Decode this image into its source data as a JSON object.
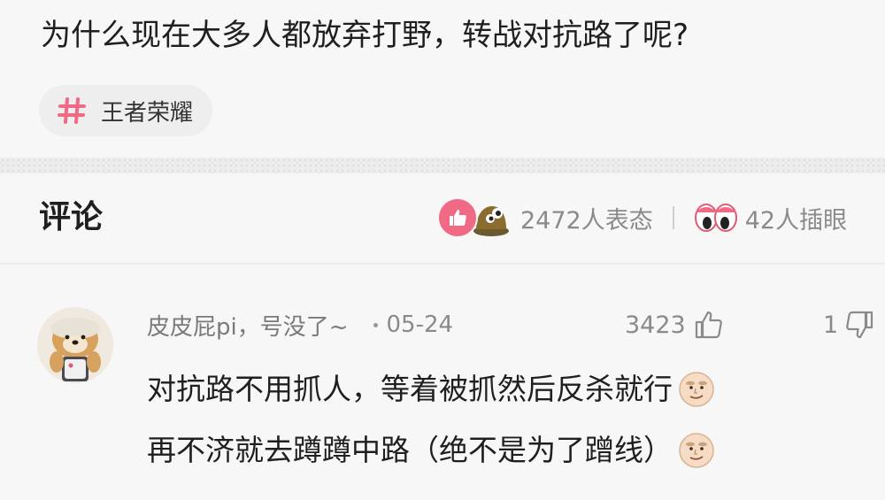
{
  "post": {
    "title": "为什么现在大多人都放弃打野，转战对抗路了呢?",
    "topic": {
      "label": "王者荣耀",
      "icon": "hashtag-icon",
      "icon_color": "#f06a86"
    }
  },
  "comments_section": {
    "title": "评论",
    "reactions": {
      "icons": [
        "like-reaction-icon",
        "lol-reaction-icon"
      ],
      "count_text": "2472人表态",
      "eyes_icon": "eyes-icon",
      "eyes_text": "42人插眼"
    }
  },
  "comment": {
    "username": "皮皮屁pi，号没了~",
    "date": "05-24",
    "like_count": "3423",
    "dislike_count": "1",
    "lines": [
      "对抗路不用抓人，等着被抓然后反杀就行",
      "再不济就去蹲蹲中路（绝不是为了蹭线）"
    ],
    "inline_emoji": "smug-face-emoji"
  },
  "colors": {
    "accent": "#f06a86",
    "background": "#f7f7f7",
    "meta_text": "#8a8a8a"
  }
}
